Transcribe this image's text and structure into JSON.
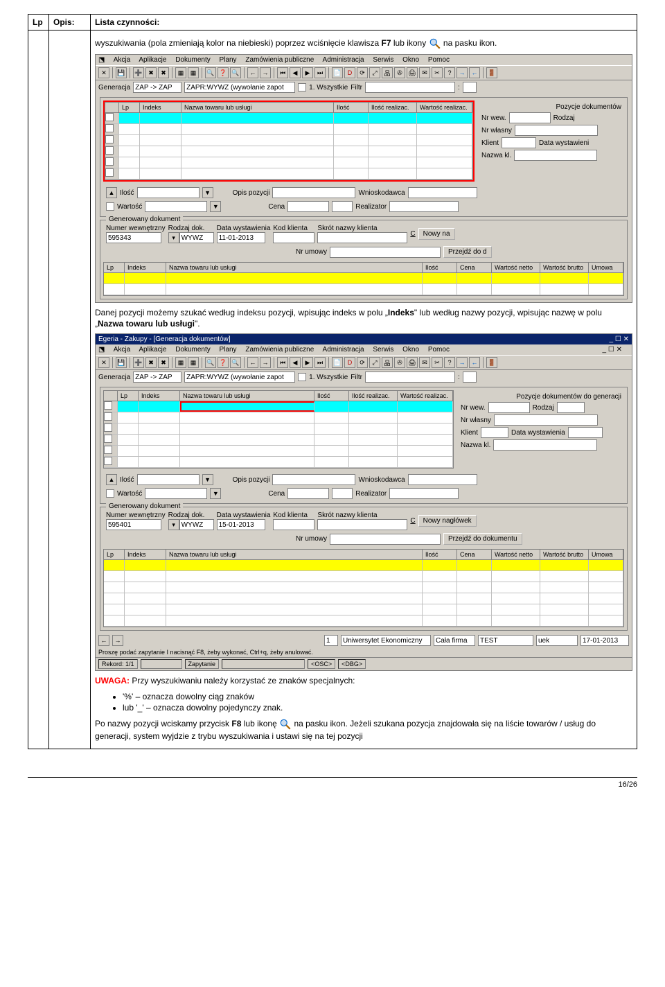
{
  "doc": {
    "headers": {
      "lp": "Lp",
      "opis": "Opis:",
      "lista": "Lista czynności:"
    },
    "para1_pre": "wyszukiwania (pola zmieniają kolor na niebieski) poprzez wciśnięcie klawisza ",
    "para1_bold": "F7",
    "para1_post": " lub ikony",
    "para1_tail": "na pasku ikon.",
    "para2_pre": "Danej pozycji możemy szukać według indeksu pozycji, wpisując indeks w polu „",
    "para2_b1": "Indeks",
    "para2_mid": "\" lub według nazwy pozycji, wpisując nazwę w polu „",
    "para2_b2": "Nazwa towaru lub usługi",
    "para2_post": "\".",
    "uwaga_label": "UWAGA:",
    "uwaga_text": " Przy wyszukiwaniu należy korzystać ze znaków specjalnych:",
    "bullet1": "'%' – oznacza dowolny ciąg znaków",
    "bullet2": "lub '_' – oznacza dowolny pojedynczy znak.",
    "para3_pre": "Po nazwy pozycji wciskamy przycisk ",
    "para3_b": "F8",
    "para3_mid": " lub ikonę ",
    "para3_tail": " na pasku ikon. Jeżeli szukana pozycja znajdowała się na liście towarów / usług do generacji, system wyjdzie z trybu wyszukiwania i ustawi się na tej pozycji",
    "page_num": "16/26"
  },
  "ss1": {
    "menu": [
      "Akcja",
      "Aplikacje",
      "Dokumenty",
      "Plany",
      "Zamówienia publiczne",
      "Administracja",
      "Serwis",
      "Okno",
      "Pomoc"
    ],
    "gen_label": "Generacja",
    "gen_val": "ZAP -> ZAP",
    "gen_val2": "ZAPR:WYWZ (wywołanie zapot",
    "wszystkie": "1. Wszystkie",
    "filtr": "Filtr",
    "poz_dok": "Pozycje dokumentów",
    "grid_head": [
      "Lp",
      "Indeks",
      "Nazwa towaru lub usługi",
      "Ilość",
      "Ilość realizac.",
      "Wartość realizac."
    ],
    "side": {
      "nrwew": "Nr wew.",
      "rodzaj": "Rodzaj",
      "nrwl": "Nr własny",
      "klient": "Klient",
      "datawst": "Data wystawieni",
      "nazwakl": "Nazwa kl."
    },
    "ilosc": "Ilość",
    "wartosc": "Wartość",
    "opisp": "Opis pozycji",
    "cena": "Cena",
    "wniosk": "Wnioskodawca",
    "realiz": "Realizator",
    "gendok": "Generowany dokument",
    "nrwewn": "Numer wewnętrzny",
    "rodzdok": "Rodzaj dok.",
    "datawst2": "Data wystawienia",
    "kodkl": "Kod klienta",
    "skrot": "Skrót nazwy klienta",
    "num": "595343",
    "wywz": "WYWZ",
    "date": "11-01-2013",
    "c": "C",
    "nowyna": "Nowy na",
    "nrumowy": "Nr umowy",
    "przejdz": "Przejdź do d",
    "grid2_head": [
      "Lp",
      "Indeks",
      "Nazwa towaru lub usługi",
      "Ilość",
      "Cena",
      "Wartość netto",
      "Wartość brutto",
      "Umowa"
    ]
  },
  "ss2": {
    "title": "Egeria - Zakupy - [Generacja dokumentów]",
    "menu": [
      "Akcja",
      "Aplikacje",
      "Dokumenty",
      "Plany",
      "Zamówienia publiczne",
      "Administracja",
      "Serwis",
      "Okno",
      "Pomoc"
    ],
    "gen_label": "Generacja",
    "gen_val": "ZAP -> ZAP",
    "gen_val2": "ZAPR:WYWZ (wywołanie zapot",
    "wszystkie": "1. Wszystkie",
    "filtr": "Filtr",
    "poz_dok": "Pozycje dokumentów do generacji",
    "grid_head": [
      "Lp",
      "Indeks",
      "Nazwa towaru lub usługi",
      "Ilość",
      "Ilość realizac.",
      "Wartość realizac."
    ],
    "side": {
      "nrwew": "Nr wew.",
      "rodzaj": "Rodzaj",
      "nrwl": "Nr własny",
      "klient": "Klient",
      "datawst": "Data wystawienia",
      "nazwakl": "Nazwa kl."
    },
    "ilosc": "Ilość",
    "wartosc": "Wartość",
    "opisp": "Opis pozycji",
    "cena": "Cena",
    "wniosk": "Wnioskodawca",
    "realiz": "Realizator",
    "gendok": "Generowany dokument",
    "nrwewn": "Numer wewnętrzny",
    "rodzdok": "Rodzaj dok.",
    "datawst2": "Data wystawienia",
    "kodkl": "Kod klienta",
    "skrot": "Skrót nazwy klienta",
    "num": "595401",
    "wywz": "WYWZ",
    "date": "15-01-2013",
    "c": "C",
    "nowynag": "Nowy nagłówek",
    "nrumowy": "Nr umowy",
    "przejdz": "Przejdź do dokumentu",
    "grid2_head": [
      "Lp",
      "Indeks",
      "Nazwa towaru lub usługi",
      "Ilość",
      "Cena",
      "Wartość netto",
      "Wartość brutto",
      "Umowa"
    ],
    "status": {
      "hint": "Proszę podać zapytanie I nacisnąć F8, żeby wykonać, Ctrl+q, żeby anulować.",
      "rekord": "Rekord: 1/1",
      "zapyt": "Zapytanie",
      "osc": "<OSC>",
      "dbg": "<DBG>",
      "s1": "1",
      "s2": "Uniwersytet Ekonomiczny",
      "s3": "Cała firma",
      "s4": "TEST",
      "s5": "uek",
      "s6": "17-01-2013"
    }
  }
}
